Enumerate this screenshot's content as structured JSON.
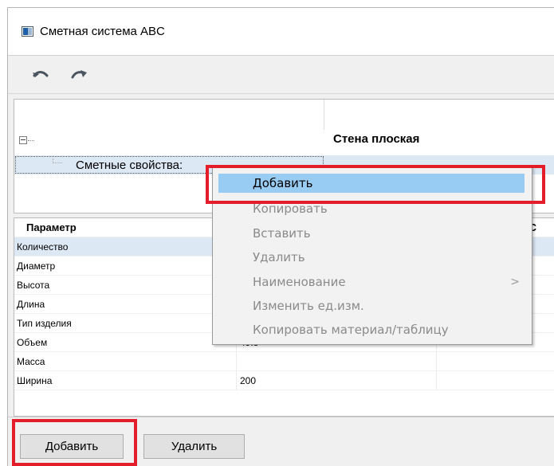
{
  "window": {
    "title": "Сметная система ABC"
  },
  "toolbar": {
    "undo_icon": "undo-icon",
    "redo_icon": "redo-icon"
  },
  "tree": {
    "object_name": "Стена плоская",
    "selected_item": "Сметные свойства:"
  },
  "grid": {
    "headers": [
      "Параметр",
      "",
      "BC"
    ],
    "rows": [
      {
        "param": "Количество",
        "value": ""
      },
      {
        "param": "Диаметр",
        "value": ""
      },
      {
        "param": "Высота",
        "value": ""
      },
      {
        "param": "Длина",
        "value": ""
      },
      {
        "param": "Тип изделия",
        "value": ""
      },
      {
        "param": "Объем",
        "value": "49.8"
      },
      {
        "param": "Масса",
        "value": ""
      },
      {
        "param": "Ширина",
        "value": "200"
      }
    ]
  },
  "context_menu": {
    "items": [
      {
        "label": "Добавить",
        "enabled": true
      },
      {
        "label": "Копировать",
        "enabled": false
      },
      {
        "label": "Вставить",
        "enabled": false
      },
      {
        "label": "Удалить",
        "enabled": false
      },
      {
        "label": "Наименование",
        "enabled": false,
        "has_submenu": true,
        "submenu_arrow": ">"
      },
      {
        "label": "Изменить ед.изм.",
        "enabled": false
      },
      {
        "label": "Копировать материал/таблицу",
        "enabled": false
      }
    ]
  },
  "buttons": {
    "add": "Добавить",
    "delete": "Удалить"
  },
  "colors": {
    "highlight": "#e31e2a",
    "menu_active": "#99ccf3",
    "row_selected": "#dde8f5"
  }
}
